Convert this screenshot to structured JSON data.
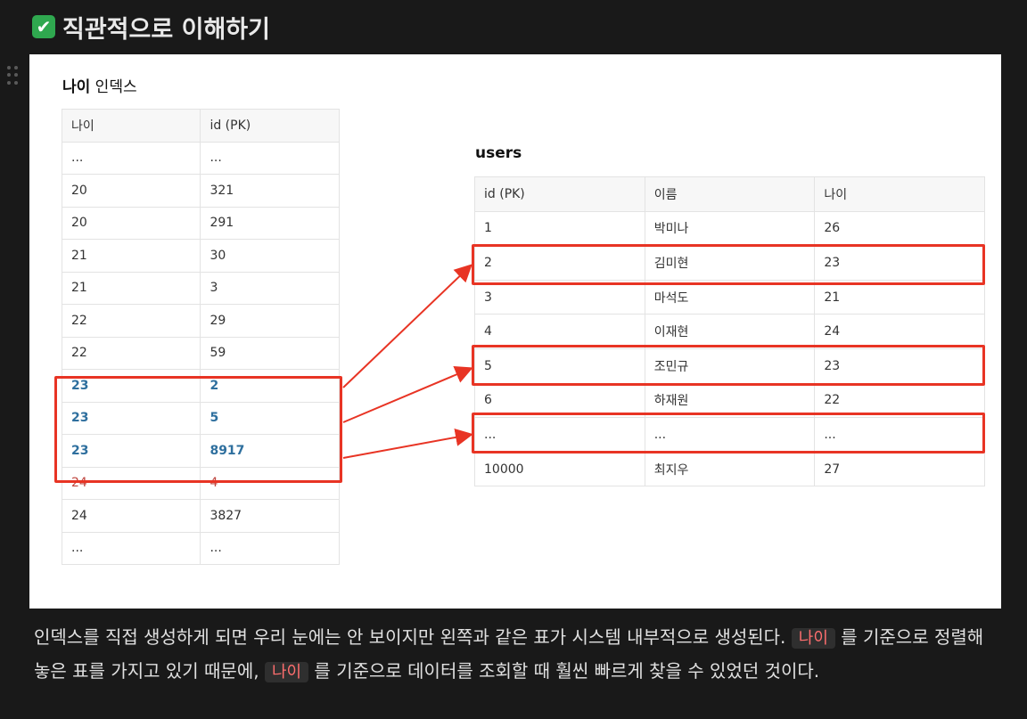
{
  "heading": {
    "icon": "check-mark-button-icon",
    "text": "직관적으로 이해하기"
  },
  "index_block": {
    "title_bold": "나이",
    "title_rest": " 인덱스",
    "headers": [
      "나이",
      "id (PK)"
    ],
    "rows": [
      [
        "...",
        "..."
      ],
      [
        "20",
        "321"
      ],
      [
        "20",
        "291"
      ],
      [
        "21",
        "30"
      ],
      [
        "21",
        "3"
      ],
      [
        "22",
        "29"
      ],
      [
        "22",
        "59"
      ],
      [
        "23",
        "2"
      ],
      [
        "23",
        "5"
      ],
      [
        "23",
        "8917"
      ],
      [
        "24",
        "4"
      ],
      [
        "24",
        "3827"
      ],
      [
        "...",
        "..."
      ]
    ]
  },
  "users_block": {
    "title": "users",
    "headers": [
      "id (PK)",
      "이름",
      "나이"
    ],
    "rows": [
      [
        "1",
        "박미나",
        "26"
      ],
      [
        "2",
        "김미현",
        "23"
      ],
      [
        "3",
        "마석도",
        "21"
      ],
      [
        "4",
        "이재현",
        "24"
      ],
      [
        "5",
        "조민규",
        "23"
      ],
      [
        "6",
        "하재원",
        "22"
      ],
      [
        "...",
        "...",
        "..."
      ],
      [
        "10000",
        "최지우",
        "27"
      ]
    ]
  },
  "colors": {
    "highlight": "#e83424",
    "index_match": "#2e6f9e",
    "index_next": "#c0463f"
  },
  "paragraph": {
    "part1": "인덱스를 직접 생성하게 되면 우리 눈에는 안 보이지만 왼쪽과 같은 표가 시스템 내부적으로 생성된다. ",
    "code1": "나이",
    "part2": " 를 기준으로 정렬해놓은 표를 가지고 있기 때문에, ",
    "code2": "나이",
    "part3": " 를 기준으로 데이터를 조회할 때 훨씬 빠르게 찾을 수 있었던 것이다."
  }
}
